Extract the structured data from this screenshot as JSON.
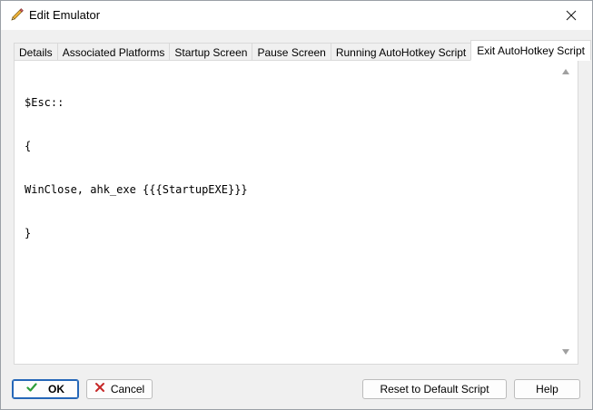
{
  "window": {
    "title": "Edit Emulator",
    "icon": "pencil-icon",
    "close_icon": "close-icon"
  },
  "tabs": [
    {
      "label": "Details",
      "active": false
    },
    {
      "label": "Associated Platforms",
      "active": false
    },
    {
      "label": "Startup Screen",
      "active": false
    },
    {
      "label": "Pause Screen",
      "active": false
    },
    {
      "label": "Running AutoHotkey Script",
      "active": false
    },
    {
      "label": "Exit AutoHotkey Script",
      "active": true
    }
  ],
  "editor": {
    "lines": [
      "$Esc::",
      "{",
      "WinClose, ahk_exe {{{StartupEXE}}}",
      "}"
    ]
  },
  "buttons": {
    "ok": {
      "label": "OK",
      "icon": "checkmark-icon"
    },
    "cancel": {
      "label": "Cancel",
      "icon": "x-icon"
    },
    "reset": {
      "label": "Reset to Default Script"
    },
    "help": {
      "label": "Help"
    }
  },
  "colors": {
    "accent": "#2567b8",
    "check_green": "#2e9e3a",
    "cancel_red": "#c62828"
  }
}
